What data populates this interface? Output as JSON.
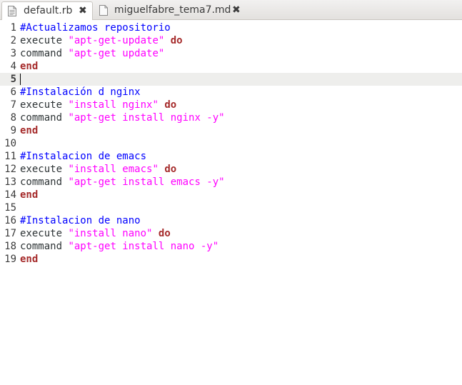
{
  "tabs": [
    {
      "label": "default.rb",
      "icon": "file-icon",
      "active": true
    },
    {
      "label": "miguelfabre_tema7.md",
      "icon": "file-icon",
      "active": false
    }
  ],
  "close_glyph": "✖",
  "current_line": 5,
  "colors": {
    "comment": "#0000ff",
    "string": "#ff00ff",
    "keyword": "#a52a2a",
    "current_line_bg": "#eeeeec"
  },
  "lines": [
    {
      "n": "1",
      "tokens": [
        {
          "t": "comment",
          "v": "#Actualizamos repositorio"
        }
      ]
    },
    {
      "n": "2",
      "tokens": [
        {
          "t": "plain",
          "v": "execute "
        },
        {
          "t": "string",
          "v": "\"apt-get-update\""
        },
        {
          "t": "plain",
          "v": " "
        },
        {
          "t": "keyword",
          "v": "do"
        }
      ]
    },
    {
      "n": "3",
      "tokens": [
        {
          "t": "plain",
          "v": "command "
        },
        {
          "t": "string",
          "v": "\"apt-get update\""
        }
      ]
    },
    {
      "n": "4",
      "tokens": [
        {
          "t": "keyword",
          "v": "end"
        }
      ]
    },
    {
      "n": "5",
      "tokens": []
    },
    {
      "n": "6",
      "tokens": [
        {
          "t": "comment",
          "v": "#Instalación d nginx"
        }
      ]
    },
    {
      "n": "7",
      "tokens": [
        {
          "t": "plain",
          "v": "execute "
        },
        {
          "t": "string",
          "v": "\"install nginx\""
        },
        {
          "t": "plain",
          "v": " "
        },
        {
          "t": "keyword",
          "v": "do"
        }
      ]
    },
    {
      "n": "8",
      "tokens": [
        {
          "t": "plain",
          "v": "command "
        },
        {
          "t": "string",
          "v": "\"apt-get install nginx -y\""
        }
      ]
    },
    {
      "n": "9",
      "tokens": [
        {
          "t": "keyword",
          "v": "end"
        }
      ]
    },
    {
      "n": "10",
      "tokens": []
    },
    {
      "n": "11",
      "tokens": [
        {
          "t": "comment",
          "v": "#Instalacion de emacs"
        }
      ]
    },
    {
      "n": "12",
      "tokens": [
        {
          "t": "plain",
          "v": "execute "
        },
        {
          "t": "string",
          "v": "\"install emacs\""
        },
        {
          "t": "plain",
          "v": " "
        },
        {
          "t": "keyword",
          "v": "do"
        }
      ]
    },
    {
      "n": "13",
      "tokens": [
        {
          "t": "plain",
          "v": "command "
        },
        {
          "t": "string",
          "v": "\"apt-get install emacs -y\""
        }
      ]
    },
    {
      "n": "14",
      "tokens": [
        {
          "t": "keyword",
          "v": "end"
        }
      ]
    },
    {
      "n": "15",
      "tokens": []
    },
    {
      "n": "16",
      "tokens": [
        {
          "t": "comment",
          "v": "#Instalacion de nano"
        }
      ]
    },
    {
      "n": "17",
      "tokens": [
        {
          "t": "plain",
          "v": "execute "
        },
        {
          "t": "string",
          "v": "\"install nano\""
        },
        {
          "t": "plain",
          "v": " "
        },
        {
          "t": "keyword",
          "v": "do"
        }
      ]
    },
    {
      "n": "18",
      "tokens": [
        {
          "t": "plain",
          "v": "command "
        },
        {
          "t": "string",
          "v": "\"apt-get install nano -y\""
        }
      ]
    },
    {
      "n": "19",
      "tokens": [
        {
          "t": "keyword",
          "v": "end"
        }
      ]
    }
  ]
}
